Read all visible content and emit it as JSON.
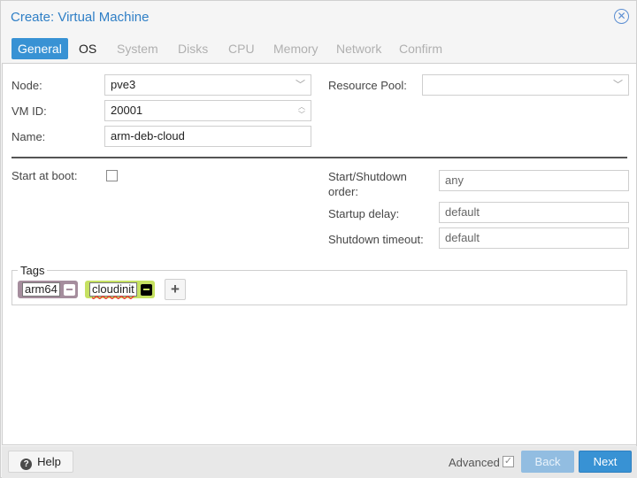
{
  "window": {
    "title": "Create: Virtual Machine",
    "close_icon": "close-circle-icon"
  },
  "tabs": [
    {
      "label": "General",
      "state": "active"
    },
    {
      "label": "OS",
      "state": "enabled"
    },
    {
      "label": "System",
      "state": "disabled"
    },
    {
      "label": "Disks",
      "state": "disabled"
    },
    {
      "label": "CPU",
      "state": "disabled"
    },
    {
      "label": "Memory",
      "state": "disabled"
    },
    {
      "label": "Network",
      "state": "disabled"
    },
    {
      "label": "Confirm",
      "state": "disabled"
    }
  ],
  "form": {
    "node": {
      "label": "Node:",
      "value": "pve3"
    },
    "vmid": {
      "label": "VM ID:",
      "value": "20001"
    },
    "name": {
      "label": "Name:",
      "value": "arm-deb-cloud"
    },
    "resource_pool": {
      "label": "Resource Pool:",
      "value": ""
    },
    "start_at_boot": {
      "label": "Start at boot:",
      "checked": false
    },
    "startup_order": {
      "label_line1": "Start/Shutdown",
      "label_line2": "order:",
      "placeholder": "any"
    },
    "startup_delay": {
      "label": "Startup delay:",
      "placeholder": "default"
    },
    "shutdown_timeout": {
      "label": "Shutdown timeout:",
      "placeholder": "default"
    }
  },
  "tags": {
    "legend": "Tags",
    "items": [
      {
        "text": "arm64",
        "color": "#a58d9d",
        "remove_color": "#ffffff",
        "remove_bg": "#ffffff"
      },
      {
        "text": "cloudinit",
        "color": "#c6e162",
        "remove_color": "#000000",
        "remove_bg": "#000000"
      }
    ],
    "add_label": "+"
  },
  "footer": {
    "help_label": "Help",
    "advanced_label": "Advanced",
    "advanced_checked": true,
    "back_label": "Back",
    "next_label": "Next"
  },
  "colors": {
    "accent": "#3892d4",
    "title": "#2f7fc6"
  }
}
